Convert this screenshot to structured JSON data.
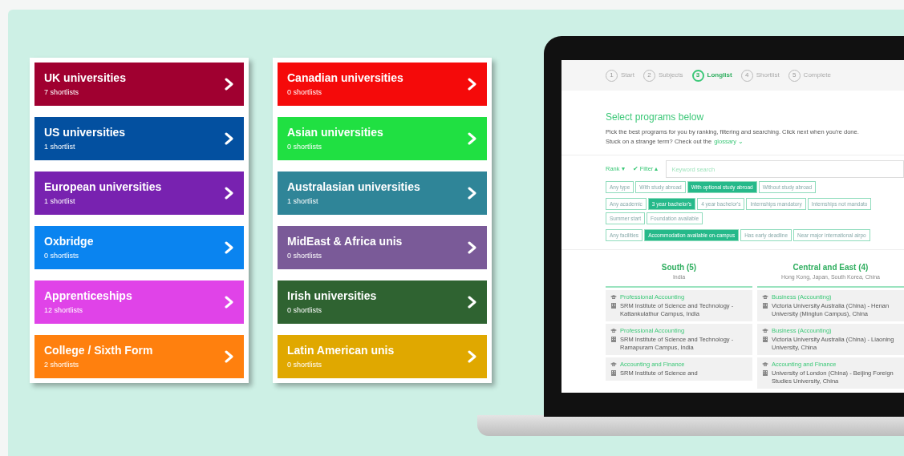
{
  "left_panel": {
    "cards": [
      {
        "title": "UK universities",
        "subtitle": "7 shortlists",
        "color": "#a00030"
      },
      {
        "title": "US universities",
        "subtitle": "1 shortlist",
        "color": "#0350a0"
      },
      {
        "title": "European universities",
        "subtitle": "1 shortlist",
        "color": "#7822b0"
      },
      {
        "title": "Oxbridge",
        "subtitle": "0 shortlists",
        "color": "#0a84f0"
      },
      {
        "title": "Apprenticeships",
        "subtitle": "12 shortlists",
        "color": "#e043e8"
      },
      {
        "title": "College / Sixth Form",
        "subtitle": "2 shortlists",
        "color": "#ff800e"
      }
    ]
  },
  "right_panel": {
    "cards": [
      {
        "title": "Canadian universities",
        "subtitle": "0 shortlists",
        "color": "#f50a0a"
      },
      {
        "title": "Asian universities",
        "subtitle": "0 shortlists",
        "color": "#20e042"
      },
      {
        "title": "Australasian universities",
        "subtitle": "1 shortlist",
        "color": "#2f8598"
      },
      {
        "title": "MidEast & Africa unis",
        "subtitle": "0 shortlists",
        "color": "#7a5a98"
      },
      {
        "title": "Irish universities",
        "subtitle": "0 shortlists",
        "color": "#2f6331"
      },
      {
        "title": "Latin American unis",
        "subtitle": "0 shortlists",
        "color": "#e0a800"
      }
    ]
  },
  "laptop_screen": {
    "steps": [
      {
        "number": "1",
        "label": "Start",
        "selected": false
      },
      {
        "number": "2",
        "label": "Subjects",
        "selected": false
      },
      {
        "number": "3",
        "label": "Longlist",
        "selected": true
      },
      {
        "number": "4",
        "label": "Shortlist",
        "selected": false
      },
      {
        "number": "5",
        "label": "Complete",
        "selected": false
      }
    ],
    "heading": "Select programs below",
    "intro": "Pick the best programs for you by ranking, filtering and searching. Click next when you're done.",
    "glossary_prompt": "Stuck on a strange term? Check out the",
    "glossary_link": "glossary ⌄",
    "rank_button": "Rank ▾",
    "filter_button": "✔ Filter ▴",
    "search": {
      "placeholder": "Keyword search"
    },
    "filter_rows": [
      [
        {
          "label": "Any type",
          "selected": false
        },
        {
          "label": "With study abroad",
          "selected": false
        },
        {
          "label": "With optional study abroad",
          "selected": true
        },
        {
          "label": "Without study abroad",
          "selected": false
        }
      ],
      [
        {
          "label": "Any academic",
          "selected": false
        },
        {
          "label": "3 year bachelor's",
          "selected": true
        },
        {
          "label": "4 year bachelor's",
          "selected": false
        },
        {
          "label": "Internships mandatory",
          "selected": false
        },
        {
          "label": "Internships not mandato",
          "selected": false
        }
      ],
      [
        {
          "label": "Summer start",
          "selected": false
        },
        {
          "label": "Foundation available",
          "selected": false
        }
      ],
      [
        {
          "label": "Any facilities",
          "selected": false
        },
        {
          "label": "Accommodation available on-campus",
          "selected": true
        },
        {
          "label": "Has early deadline",
          "selected": false
        },
        {
          "label": "Near major international airpo",
          "selected": false
        }
      ]
    ],
    "columns": [
      {
        "title": "South (5)",
        "subtitle": "India",
        "items": [
          {
            "program": "Professional Accounting",
            "institution": "SRM Institute of Science and Technology - Kattankulathur Campus, India"
          },
          {
            "program": "Professional Accounting",
            "institution": "SRM Institute of Science and Technology - Ramapuram Campus, India"
          },
          {
            "program": "Accounting and Finance",
            "institution": "SRM Institute of Science and"
          }
        ]
      },
      {
        "title": "Central and East (4)",
        "subtitle": "Hong Kong, Japan, South Korea, China",
        "items": [
          {
            "program": "Business (Accounting)",
            "institution": "Victoria University Australia (China) - Henan University (Minglun Campus), China"
          },
          {
            "program": "Business (Accounting)",
            "institution": "Victoria University Australia (China) - Liaoning University, China"
          },
          {
            "program": "Accounting and Finance",
            "institution": "University of London (China) - Beijing Foreign Studies University, China"
          }
        ]
      }
    ]
  }
}
